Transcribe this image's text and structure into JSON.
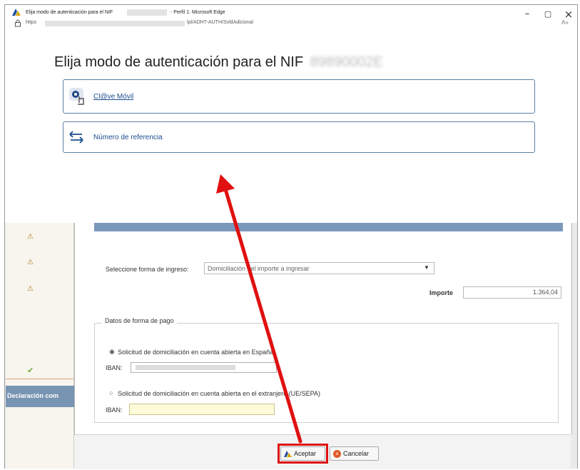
{
  "window": {
    "title_prefix": "Elija modo de autenticación para el NIF",
    "title_suffix": "- Perfil 1: Microsoft Edge",
    "controls": {
      "minimize": "–",
      "maximize": "▢",
      "close": "×"
    }
  },
  "address_bar": {
    "prefix": "https",
    "suffix": "lpl/ADHT-AUTH/SvldAdicional",
    "read_aloud": "A»"
  },
  "popup": {
    "title": "Elija modo de autenticación para el NIF",
    "nif": "89890002E",
    "options": [
      {
        "label": "Cl@ve Móvil",
        "icon": "clave-movil-icon"
      },
      {
        "label": "Número de referencia",
        "icon": "swap-arrows-icon"
      }
    ]
  },
  "form": {
    "forma_ingreso_label": "Seleccione forma de ingreso:",
    "forma_ingreso_value": "Domiciliación del importe a ingresar",
    "importe_label": "Importe",
    "importe_value": "1.364,04",
    "datos_pago_legend": "Datos de forma de pago",
    "radio_espana_label": "Solicitud de domiciliación en cuenta abierta en España",
    "iban_label": "IBAN:",
    "radio_extranjero_label": "Solicitud de domiciliación en cuenta abierta en el extranjero (UE/SEPA)"
  },
  "sidebar": {
    "declaracion_label": "Declaración com"
  },
  "buttons": {
    "aceptar": "Aceptar",
    "cancelar": "Cancelar"
  },
  "colors": {
    "annotation_red": "#e01010",
    "option_border": "#5b7fa6",
    "link_blue": "#1a4d8f"
  }
}
